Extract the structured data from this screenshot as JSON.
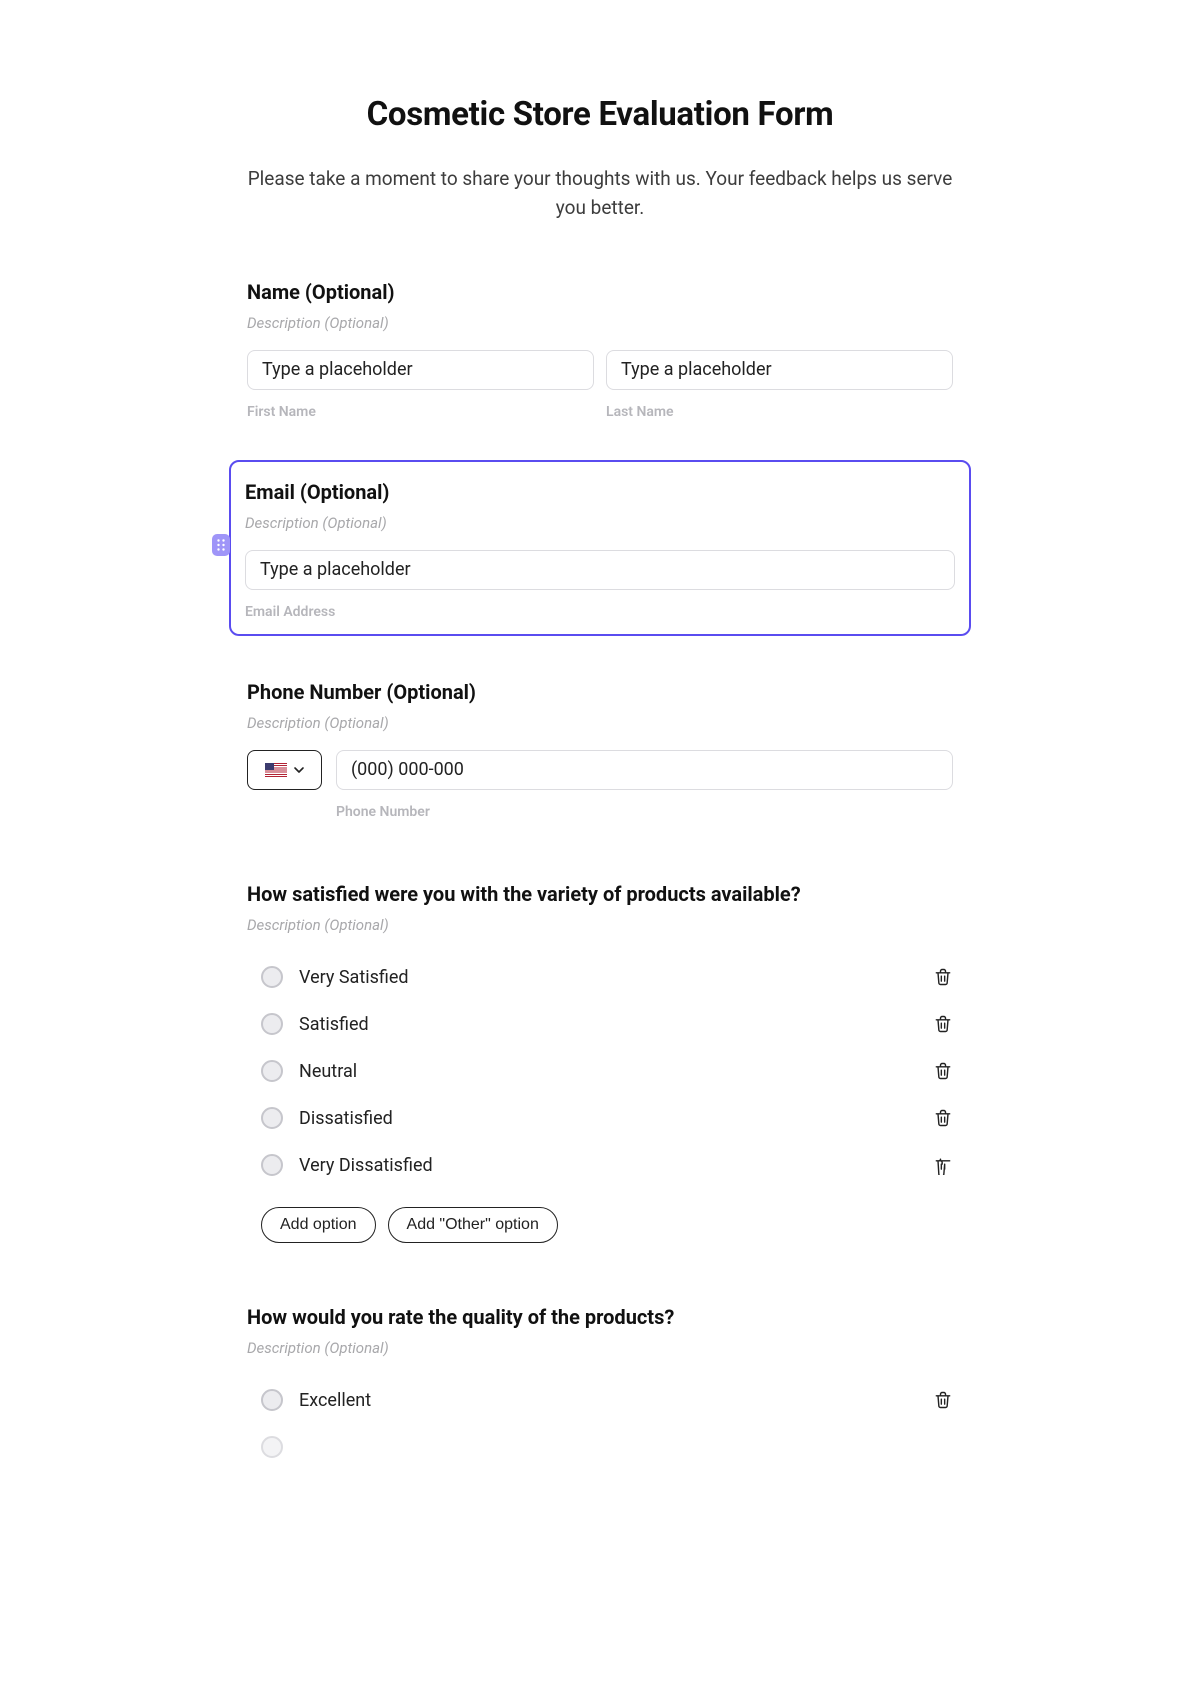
{
  "header": {
    "title": "Cosmetic Store Evaluation Form",
    "subtitle": "Please take a moment to share your thoughts with us. Your feedback helps us serve you better."
  },
  "fields": {
    "name": {
      "label": "Name (Optional)",
      "desc_placeholder": "Description (Optional)",
      "first_placeholder": "Type a placeholder",
      "first_sublabel": "First Name",
      "last_placeholder": "Type a placeholder",
      "last_sublabel": "Last Name"
    },
    "email": {
      "label": "Email (Optional)",
      "desc_placeholder": "Description (Optional)",
      "placeholder": "Type a placeholder",
      "sublabel": "Email Address"
    },
    "phone": {
      "label": "Phone Number (Optional)",
      "desc_placeholder": "Description (Optional)",
      "placeholder": "(000) 000-000",
      "sublabel": "Phone Number"
    },
    "q1": {
      "label": "How satisfied were you with the variety of products available?",
      "desc_placeholder": "Description (Optional)",
      "options": [
        "Very Satisfied",
        "Satisfied",
        "Neutral",
        "Dissatisfied",
        "Very Dissatisfied"
      ],
      "add_option_label": "Add option",
      "add_other_label": "Add \"Other\" option"
    },
    "q2": {
      "label": "How would you rate the quality of the products?",
      "desc_placeholder": "Description (Optional)",
      "options": [
        "Excellent"
      ]
    }
  }
}
